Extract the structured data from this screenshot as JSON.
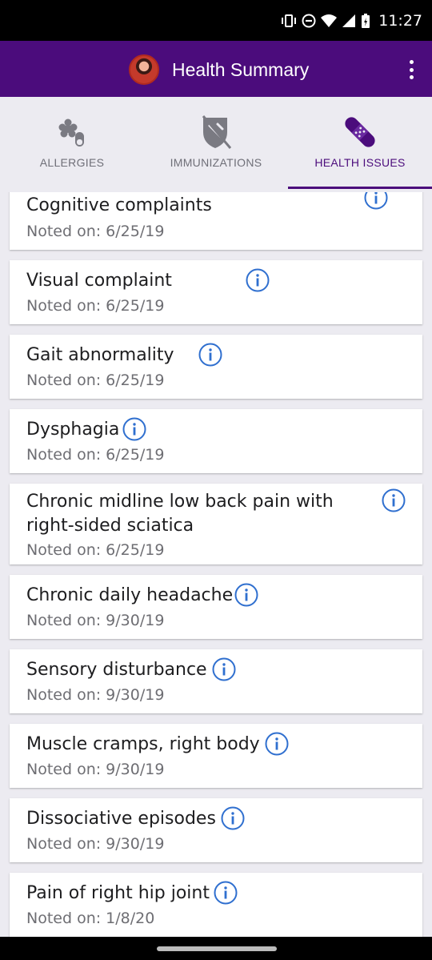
{
  "status_bar": {
    "time": "11:27",
    "icons": [
      "vibrate-icon",
      "do-not-disturb-icon",
      "wifi-icon",
      "signal-icon",
      "battery-charging-icon"
    ]
  },
  "app_bar": {
    "title": "Health Summary",
    "background_color": "#4b0c7c",
    "menu_icon": "more-vert-icon"
  },
  "tabs": [
    {
      "label": "ALLERGIES",
      "icon": "allergies-icon",
      "active": false
    },
    {
      "label": "IMMUNIZATIONS",
      "icon": "immunizations-icon",
      "active": false
    },
    {
      "label": "HEALTH ISSUES",
      "icon": "bandage-icon",
      "active": true
    }
  ],
  "accent_color": "#4b0c7c",
  "info_icon_color": "#2f6fcf",
  "health_issues": [
    {
      "title": "Cognitive complaints",
      "date": "Noted on: 6/25/19"
    },
    {
      "title": "Visual complaint",
      "date": "Noted on: 6/25/19"
    },
    {
      "title": "Gait abnormality",
      "date": "Noted on: 6/25/19"
    },
    {
      "title": "Dysphagia",
      "date": "Noted on: 6/25/19"
    },
    {
      "title_line1": "Chronic midline low back pain with",
      "title_line2": "right-sided sciatica",
      "date": "Noted on: 6/25/19"
    },
    {
      "title": "Chronic daily headache",
      "date": "Noted on: 9/30/19"
    },
    {
      "title": "Sensory disturbance",
      "date": "Noted on: 9/30/19"
    },
    {
      "title": "Muscle cramps, right body",
      "date": "Noted on: 9/30/19"
    },
    {
      "title": "Dissociative episodes",
      "date": "Noted on: 9/30/19"
    },
    {
      "title": "Pain of right hip joint",
      "date": "Noted on: 1/8/20"
    }
  ]
}
